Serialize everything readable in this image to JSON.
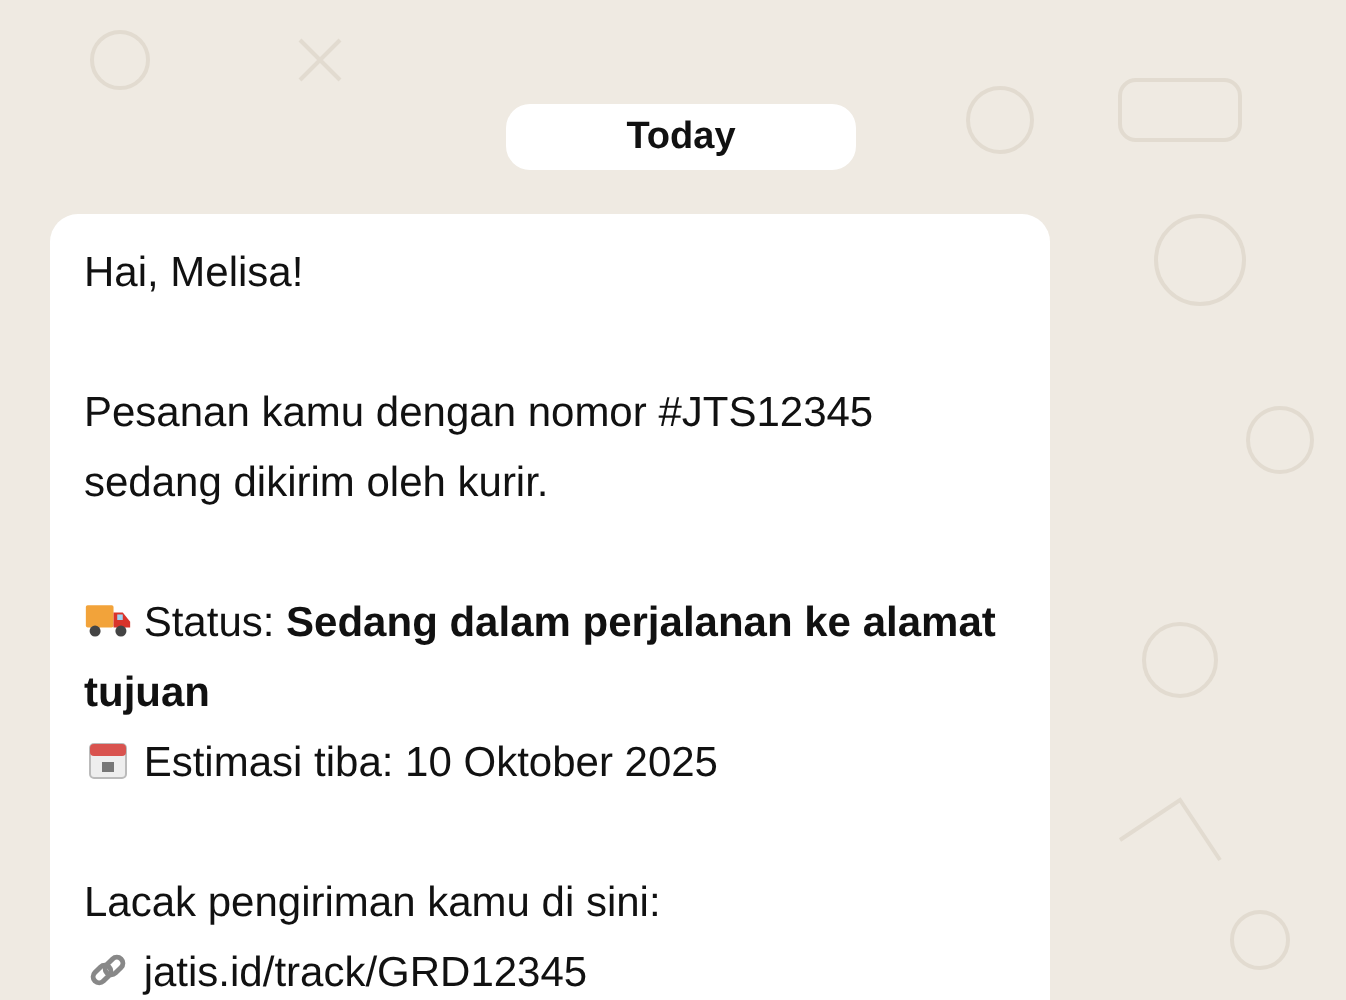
{
  "date_chip": "Today",
  "message": {
    "greeting": "Hai, Melisa!",
    "body": "Pesanan kamu dengan nomor #JTS12345 sedang dikirim oleh kurir.",
    "status": "Status: **Sedang dalam perjalanan ke alamat tujuan**",
    "estimate": "Estimasi tiba: 10 Oktober 2025",
    "track_label": "Lacak pengiriman kamu di sini:",
    "track_link": "jatis.id/track/GRD12345"
  }
}
